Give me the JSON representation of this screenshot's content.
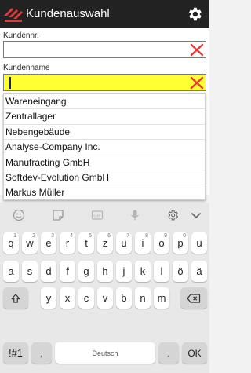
{
  "appbar": {
    "title": "Kundenauswahl",
    "logo_icon": "company-logo",
    "settings_icon": "gear-icon"
  },
  "form": {
    "customer_number": {
      "label": "Kundennr.",
      "value": ""
    },
    "customer_name": {
      "label": "Kundenname",
      "value": ""
    },
    "clear_icon": "red-x-icon"
  },
  "dropdown": {
    "items": [
      "Wareneingang",
      "Zentrallager",
      "Nebengebäude",
      "Analyse-Company Inc.",
      "Manufracting GmbH",
      "Softdev-Evolution GmbH",
      "Markus Müller"
    ]
  },
  "keyboard": {
    "toolbar": [
      "emoji-icon",
      "sticker-icon",
      "gif-icon",
      "mic-icon",
      "gear-icon",
      "chevron-down-icon"
    ],
    "row1": [
      {
        "key": "q",
        "hint": "1"
      },
      {
        "key": "w",
        "hint": "2"
      },
      {
        "key": "e",
        "hint": "3"
      },
      {
        "key": "r",
        "hint": "4"
      },
      {
        "key": "t",
        "hint": "5"
      },
      {
        "key": "z",
        "hint": "6"
      },
      {
        "key": "u",
        "hint": "7"
      },
      {
        "key": "i",
        "hint": "8"
      },
      {
        "key": "o",
        "hint": "9"
      },
      {
        "key": "p",
        "hint": "0"
      },
      {
        "key": "ü",
        "hint": ""
      }
    ],
    "row2": [
      "a",
      "s",
      "d",
      "f",
      "g",
      "h",
      "j",
      "k",
      "l",
      "ö",
      "ä"
    ],
    "row3": [
      "y",
      "x",
      "c",
      "v",
      "b",
      "n",
      "m"
    ],
    "symbols_label": "!#1",
    "comma_label": ",",
    "space_label": "Deutsch",
    "period_label": ".",
    "ok_label": "OK"
  },
  "colors": {
    "appbar": "#222222",
    "active_field": "#ffff33",
    "clear_icon": "#e53935"
  }
}
